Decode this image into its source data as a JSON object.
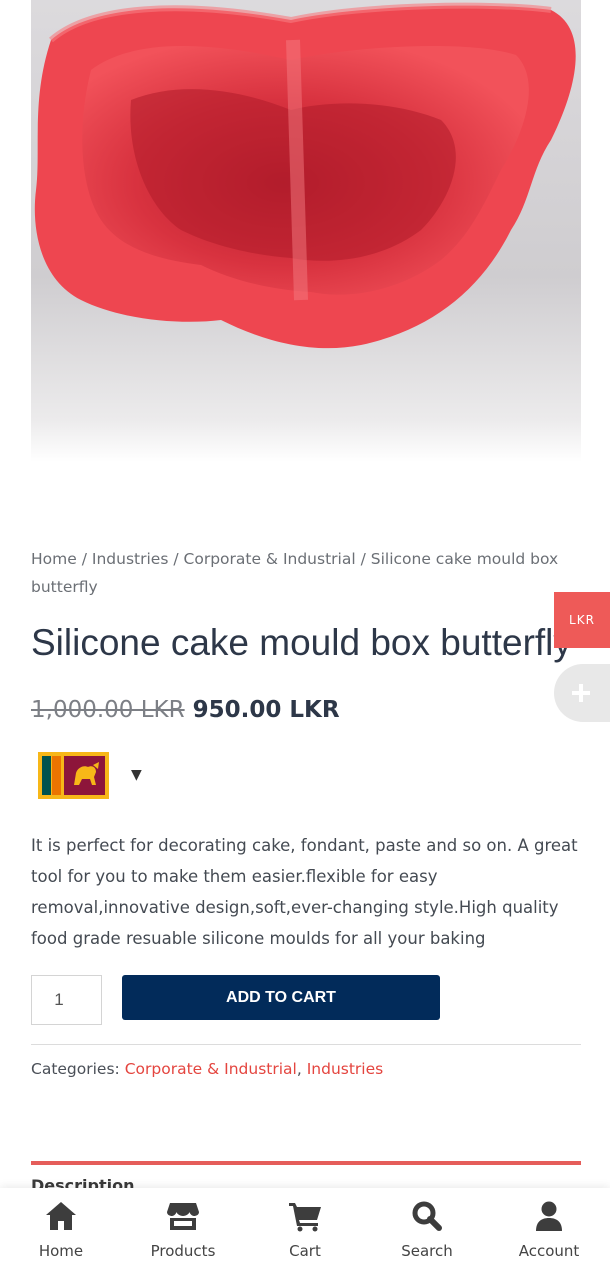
{
  "breadcrumb": {
    "home": "Home",
    "separator": "/",
    "industries": "Industries",
    "corporate": "Corporate & Industrial",
    "current": "Silicone cake mould box butterfly"
  },
  "product": {
    "title": "Silicone cake mould box butterfly",
    "old_price": "1,000.00 LKR",
    "price": "950.00 LKR",
    "short_description": "It is perfect for decorating cake, fondant, paste and so on. A great tool for you to make them easier.flexible for easy removal,innovative design,soft,ever-changing style.High quality food grade resuable silicone moulds for all your baking",
    "quantity": "1",
    "add_to_cart_label": "ADD TO CART",
    "image_icon": "red-butterfly-silicone-mould-photo"
  },
  "currency": {
    "side_tab_label": "LKR",
    "add_icon": "plus-icon",
    "flag_icon": "sri-lanka-flag-icon",
    "caret": "▼"
  },
  "categories": {
    "label": "Categories:",
    "items": [
      "Corporate & Industrial",
      "Industries"
    ],
    "separator": ","
  },
  "tabs": {
    "description_label": "Description"
  },
  "bottom_nav": {
    "items": [
      {
        "label": "Home",
        "icon": "home-icon"
      },
      {
        "label": "Products",
        "icon": "store-icon"
      },
      {
        "label": "Cart",
        "icon": "cart-icon"
      },
      {
        "label": "Search",
        "icon": "search-icon"
      },
      {
        "label": "Account",
        "icon": "user-icon"
      }
    ]
  },
  "colors": {
    "accent_red": "#e4453f",
    "navy_button": "#022b5a",
    "title": "#2d3748"
  }
}
